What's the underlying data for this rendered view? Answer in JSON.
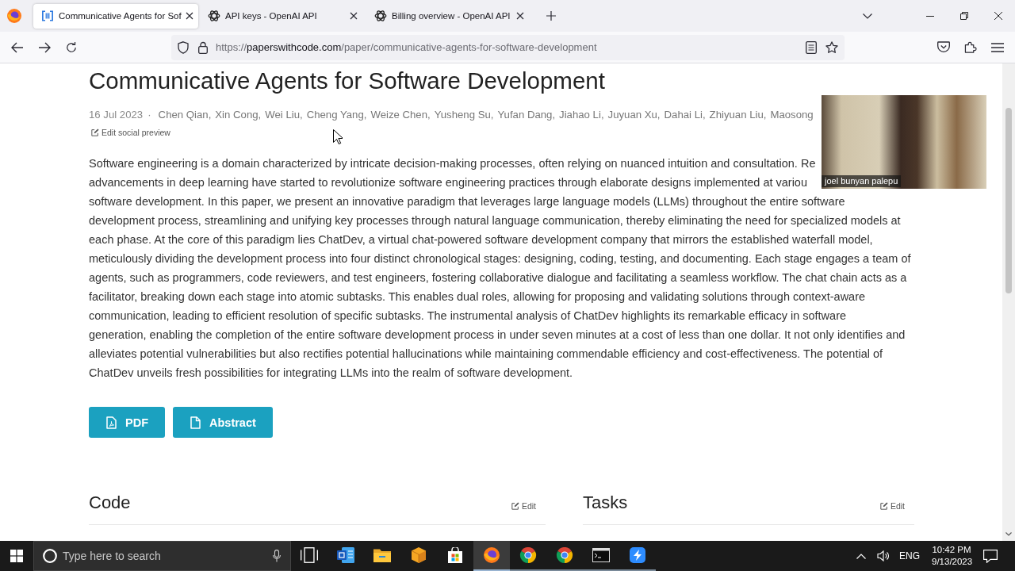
{
  "browser": {
    "tabs": [
      {
        "title": "Communicative Agents for Sof",
        "kind": "paper",
        "selected": true
      },
      {
        "title": "API keys - OpenAI API",
        "kind": "knot",
        "selected": false
      },
      {
        "title": "Billing overview - OpenAI API",
        "kind": "knot",
        "selected": false
      }
    ],
    "url": {
      "scheme": "https://",
      "host": "paperswithcode.com",
      "path": "/paper/communicative-agents-for-software-development"
    }
  },
  "paper": {
    "title": "Communicative Agents for Software Development",
    "date": "16 Jul 2023",
    "separator": "·",
    "authors": [
      "Chen Qian,",
      "Xin Cong,",
      "Wei Liu,",
      "Cheng Yang,",
      "Weize Chen,",
      "Yusheng Su,",
      "Yufan Dang,",
      "Jiahao Li,",
      "Juyuan Xu,",
      "Dahai Li,",
      "Zhiyuan Liu,",
      "Maosong"
    ],
    "edit_link": "Edit social preview",
    "abstract_lines": [
      "Software engineering is a domain characterized by intricate decision-making processes, often relying on nuanced intuition and consultation. Re",
      "advancements in deep learning have started to revolutionize software engineering practices through elaborate designs implemented at variou",
      "software development. In this paper, we present an innovative paradigm that leverages large language models (LLMs) throughout the entire software",
      "development process, streamlining and unifying key processes through natural language communication, thereby eliminating the need for specialized models at",
      "each phase. At the core of this paradigm lies ChatDev, a virtual chat-powered software development company that mirrors the established waterfall model,",
      "meticulously dividing the development process into four distinct chronological stages: designing, coding, testing, and documenting. Each stage engages a team of",
      "agents, such as programmers, code reviewers, and test engineers, fostering collaborative dialogue and facilitating a seamless workflow. The chat chain acts as a",
      "facilitator, breaking down each stage into atomic subtasks. This enables dual roles, allowing for proposing and validating solutions through context-aware",
      "communication, leading to efficient resolution of specific subtasks. The instrumental analysis of ChatDev highlights its remarkable efficacy in software",
      "generation, enabling the completion of the entire software development process in under seven minutes at a cost of less than one dollar. It not only identifies and",
      "alleviates potential vulnerabilities but also rectifies potential hallucinations while maintaining commendable efficiency and cost-effectiveness. The potential of",
      "ChatDev unveils fresh possibilities for integrating LLMs into the realm of software development."
    ],
    "buttons": [
      {
        "label": "PDF",
        "kind": "pdf"
      },
      {
        "label": "Abstract",
        "kind": "doc"
      }
    ]
  },
  "sections": [
    {
      "heading": "Code",
      "edit_label": "Edit"
    },
    {
      "heading": "Tasks",
      "edit_label": "Edit"
    }
  ],
  "video_call": {
    "participant_name": "joel bunyan palepu"
  },
  "taskbar": {
    "search_placeholder": "Type here to search",
    "apps": [
      {
        "kind": "taskview",
        "selected": false,
        "running": false
      },
      {
        "kind": "word",
        "selected": false,
        "running": false
      },
      {
        "kind": "folder",
        "selected": false,
        "running": false
      },
      {
        "kind": "package",
        "selected": false,
        "running": false
      },
      {
        "kind": "store",
        "selected": false,
        "running": false
      },
      {
        "kind": "firefox",
        "selected": true,
        "running": true
      },
      {
        "kind": "chrome",
        "selected": false,
        "running": true
      },
      {
        "kind": "chrome",
        "selected": false,
        "running": true
      },
      {
        "kind": "terminal",
        "selected": false,
        "running": true
      },
      {
        "kind": "zigzag",
        "selected": false,
        "running": true
      }
    ],
    "language": "ENG",
    "time": "10:42 PM",
    "date": "9/13/2023"
  }
}
